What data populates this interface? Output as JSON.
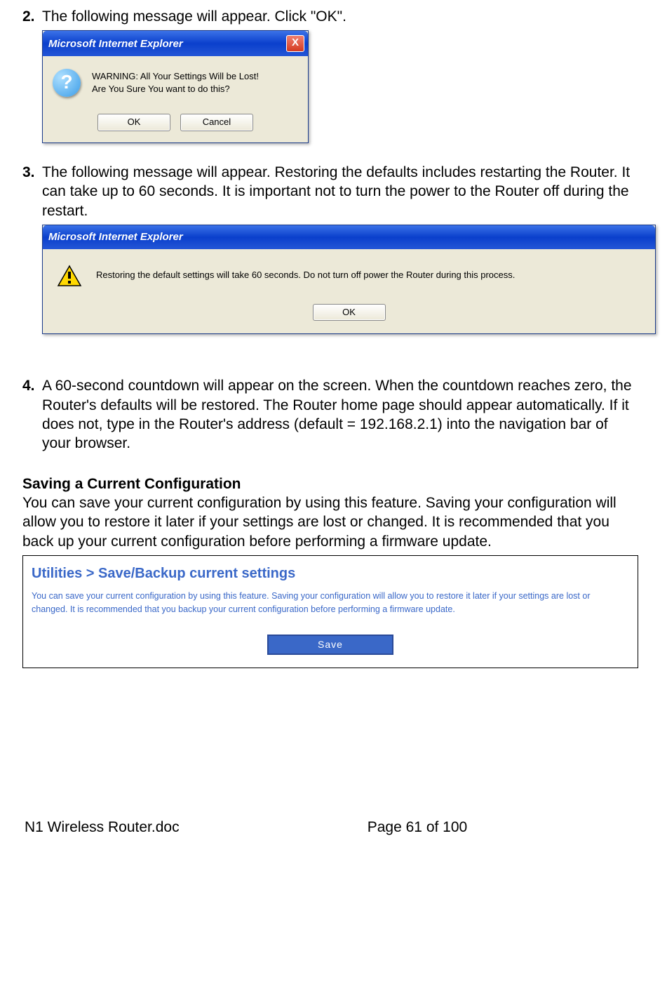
{
  "step2": {
    "num": "2.",
    "text": "The following message will appear. Click \"OK\"."
  },
  "dialog1": {
    "title": "Microsoft Internet Explorer",
    "line1": "WARNING: All Your Settings Will be Lost!",
    "line2": "Are You Sure You want to do this?",
    "ok": "OK",
    "cancel": "Cancel",
    "close": "X"
  },
  "step3": {
    "num": "3.",
    "text": "The following message will appear. Restoring the defaults includes restarting the Router. It can take up to 60 seconds. It is important not to turn the power to the Router off during the restart."
  },
  "dialog2": {
    "title": "Microsoft Internet Explorer",
    "message": "Restoring the default settings will take 60 seconds. Do not turn off power the Router during this process.",
    "ok": "OK"
  },
  "step4": {
    "num": "4.",
    "text": "A 60-second countdown will appear on the screen. When the countdown reaches zero, the Router's defaults will be restored. The Router home page should appear automatically. If it does not, type in the Router's address (default = 192.168.2.1) into the navigation bar of your browser."
  },
  "saving": {
    "heading": "Saving a Current Configuration",
    "body": "You can save your current configuration by using this feature. Saving your configuration will allow you to restore it later if your settings are lost or changed. It is recommended that you back up your current configuration before performing a firmware update."
  },
  "utilities": {
    "title": "Utilities > Save/Backup current settings",
    "desc": "You can save your current configuration by using this feature. Saving your configuration will allow you to restore it later if your settings are lost or changed. It is recommended that you backup your current configuration before performing a firmware update.",
    "save": "Save"
  },
  "footer": {
    "doc": "N1 Wireless Router.doc",
    "page": "Page 61 of 100"
  }
}
